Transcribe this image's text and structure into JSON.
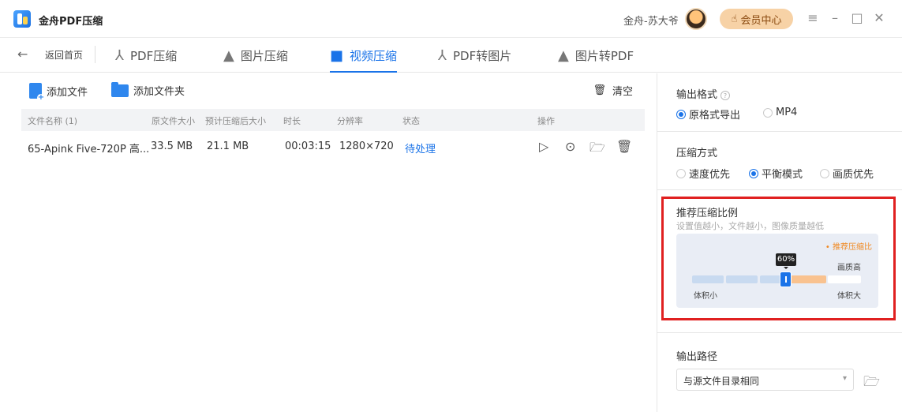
{
  "titlebar": {
    "app_title": "金舟PDF压缩",
    "user_name": "金舟-苏大爷",
    "vip_label": "会员中心",
    "menu_icon": "≡",
    "minimize_icon": "–",
    "maximize_icon": "□",
    "close_icon": "✕"
  },
  "nav": {
    "back_icon": "←",
    "home_label": "返回首页",
    "tabs": [
      {
        "label": "PDF压缩",
        "icon": "⅄"
      },
      {
        "label": "图片压缩",
        "icon": "▲"
      },
      {
        "label": "视频压缩",
        "icon": "■"
      },
      {
        "label": "PDF转图片",
        "icon": "⅄"
      },
      {
        "label": "图片转PDF",
        "icon": "▲"
      }
    ],
    "active_tab": "视频压缩"
  },
  "toolbar": {
    "add_file_label": "添加文件",
    "add_folder_label": "添加文件夹",
    "clear_label": "清空",
    "clear_icon": "🗑"
  },
  "table": {
    "headers": [
      "文件名称 (1)",
      "原文件大小",
      "预计压缩后大小",
      "时长",
      "分辨率",
      "状态",
      "操作"
    ],
    "rows": [
      {
        "name": "65-Apink Five-720P 高...",
        "orig_size": "33.5 MB",
        "est_size": "21.1 MB",
        "duration": "00:03:15",
        "resolution": "1280×720",
        "status": "待处理"
      }
    ],
    "op_icons": {
      "play": "▷",
      "settings": "⊙",
      "folder": "🗁",
      "delete": "🗑"
    }
  },
  "panel": {
    "output_format": {
      "title": "输出格式",
      "help_icon": "?",
      "options": [
        "原格式导出",
        "MP4"
      ],
      "selected": "原格式导出"
    },
    "compress_mode": {
      "title": "压缩方式",
      "options": [
        "速度优先",
        "平衡模式",
        "画质优先"
      ],
      "selected": "平衡模式"
    },
    "ratio": {
      "title": "推荐压缩比例",
      "subtitle": "设置值越小，文件越小，图像质量越低",
      "recommend_label": "• 推荐压缩比",
      "value_label": "60%",
      "value": 0.6,
      "high_quality_label": "画质高",
      "small_label": "体积小",
      "big_label": "体积大"
    },
    "output_path": {
      "title": "输出路径",
      "selected": "与源文件目录相同",
      "arrow": "▾",
      "folder_icon": "🗁"
    }
  },
  "colors": {
    "accent": "#1a73e8",
    "highlight_box": "#e02020",
    "recommend": "#f08a24"
  }
}
